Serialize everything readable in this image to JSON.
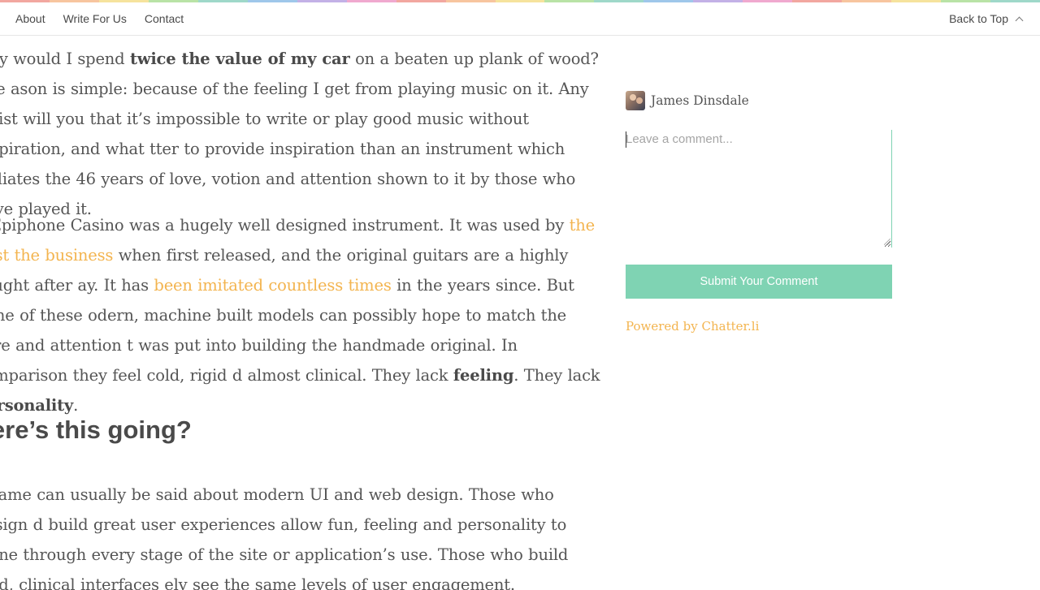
{
  "stripe_colors": [
    "#f2a7a0",
    "#f7c59f",
    "#f6e39d",
    "#b9e3a6",
    "#9fd8c9",
    "#9fc7ea",
    "#c3b1e6",
    "#f0a9cf",
    "#f2a7a0",
    "#f7c59f",
    "#f6e39d",
    "#b9e3a6",
    "#9fd8c9",
    "#9fc7ea",
    "#c3b1e6",
    "#f0a9cf",
    "#f2a7a0",
    "#f7c59f",
    "#f6e39d",
    "#b9e3a6",
    "#9fd8c9"
  ],
  "nav": {
    "about": "About",
    "write_for_us": "Write For Us",
    "contact": "Contact",
    "back_to_top": "Back to Top"
  },
  "article": {
    "p1": {
      "t1": "why would I spend ",
      "b1": "twice the value of my car",
      "t2": " on a beaten up plank of wood? The ason is simple: because of the feeling I get from playing music on it. Any artist will you that it’s impossible to write or play good music without inspiration, and what tter to provide inspiration than an instrument which radiates the 46 years of love, votion and attention shown to it by those who have played it."
    },
    "p2": {
      "t1": "e Epiphone Casino was a hugely well designed instrument. It was used by ",
      "link1": "the best the business",
      "t2": " when first released, and the original guitars are a highly sought after ay. It has ",
      "link2": "been imitated countless times",
      "t3": " in the years since. But none of these odern, machine built models can possibly hope to match the care and attention t was put into building the handmade original. In comparison they feel cold, rigid d almost clinical. They lack ",
      "b1": "feeling",
      "t4": ". They lack ",
      "b2": "personality",
      "t5": "."
    },
    "heading": "here’s this going?",
    "p3": "e same can usually be said about modern UI and web design. Those who design d build great user experiences allow fun, feeling and personality to shine through every stage of the site or application’s use. Those who build cold, clinical interfaces ely see the same levels of user engagement."
  },
  "sidebar": {
    "user_name": "James Dinsdale",
    "comment_placeholder": "Leave a comment...",
    "submit_label": "Submit Your Comment",
    "powered_by": "Powered by Chatter.li"
  },
  "colors": {
    "accent_green": "#7fd3b3",
    "link_orange": "#f3b44f",
    "text": "#555555"
  }
}
